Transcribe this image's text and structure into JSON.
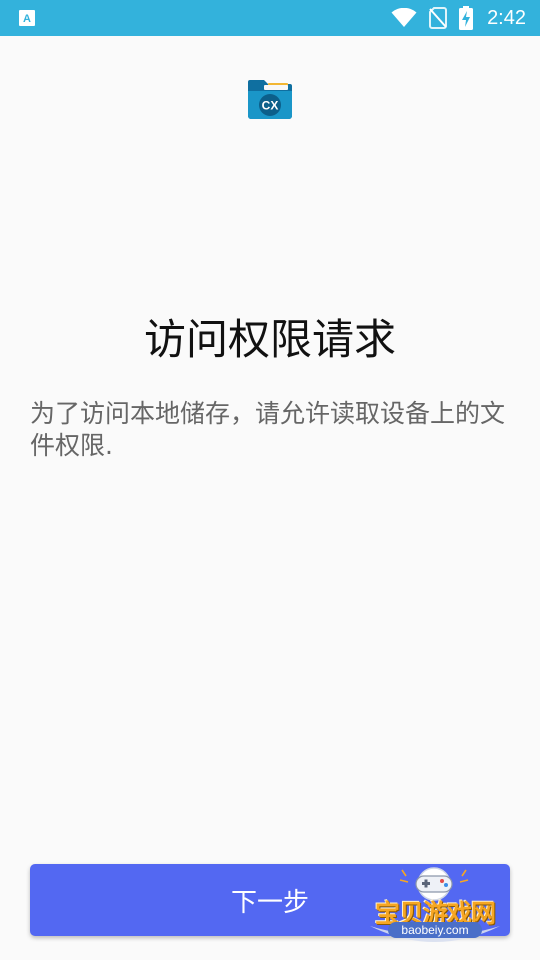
{
  "status_bar": {
    "time": "2:42",
    "icons": [
      "accessibility-a-icon",
      "wifi-icon",
      "no-sim-icon",
      "battery-charging-icon"
    ]
  },
  "app": {
    "logo_text": "CX",
    "brand_color": "#1a96c8"
  },
  "permission": {
    "title": "访问权限请求",
    "description": "为了访问本地储存，请允许读取设备上的文件权限."
  },
  "button": {
    "next_label": "下一步",
    "color": "#5368f2"
  },
  "watermark": {
    "title": "宝贝游戏网",
    "url": "baobeiy.com"
  }
}
